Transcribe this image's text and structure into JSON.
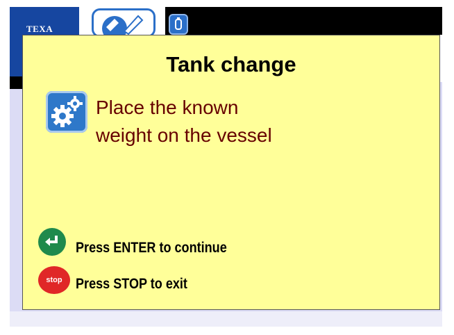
{
  "brand": {
    "logo_text": "TEXA"
  },
  "dialog": {
    "title": "Tank change",
    "message_line1": "Place the known",
    "message_line2": "weight on the vessel",
    "enter_text": "Press ENTER to continue",
    "stop_text": "Press STOP to exit",
    "stop_icon_text": "stop"
  },
  "icons": {
    "info": "gears-icon",
    "enter": "enter-arrow-icon",
    "stop": "stop-icon"
  },
  "colors": {
    "dialog_background": "#ffff99",
    "message_text": "#660000",
    "enter_button": "#1f8a4c",
    "stop_button": "#e02727",
    "brand_blue": "#1646a0"
  }
}
